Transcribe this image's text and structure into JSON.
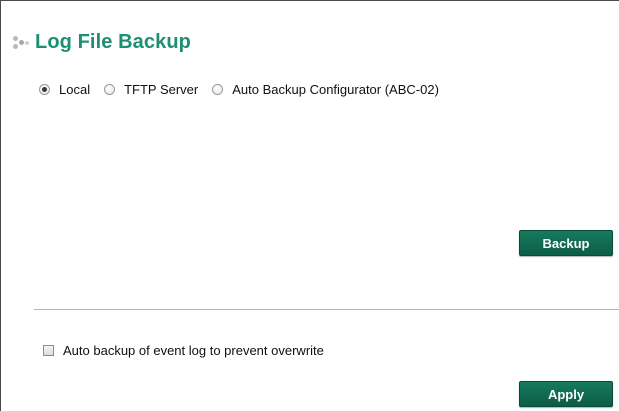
{
  "page": {
    "title": "Log File Backup",
    "accent_color": "#1d8f73",
    "button_color": "#0f6b50"
  },
  "target": {
    "selected": "Local",
    "options": [
      {
        "label": "Local",
        "checked": true
      },
      {
        "label": "TFTP Server",
        "checked": false
      },
      {
        "label": "Auto Backup Configurator (ABC-02)",
        "checked": false
      }
    ]
  },
  "actions": {
    "backup_label": "Backup",
    "apply_label": "Apply"
  },
  "auto_backup": {
    "label": "Auto backup of event log to prevent overwrite",
    "checked": false
  }
}
